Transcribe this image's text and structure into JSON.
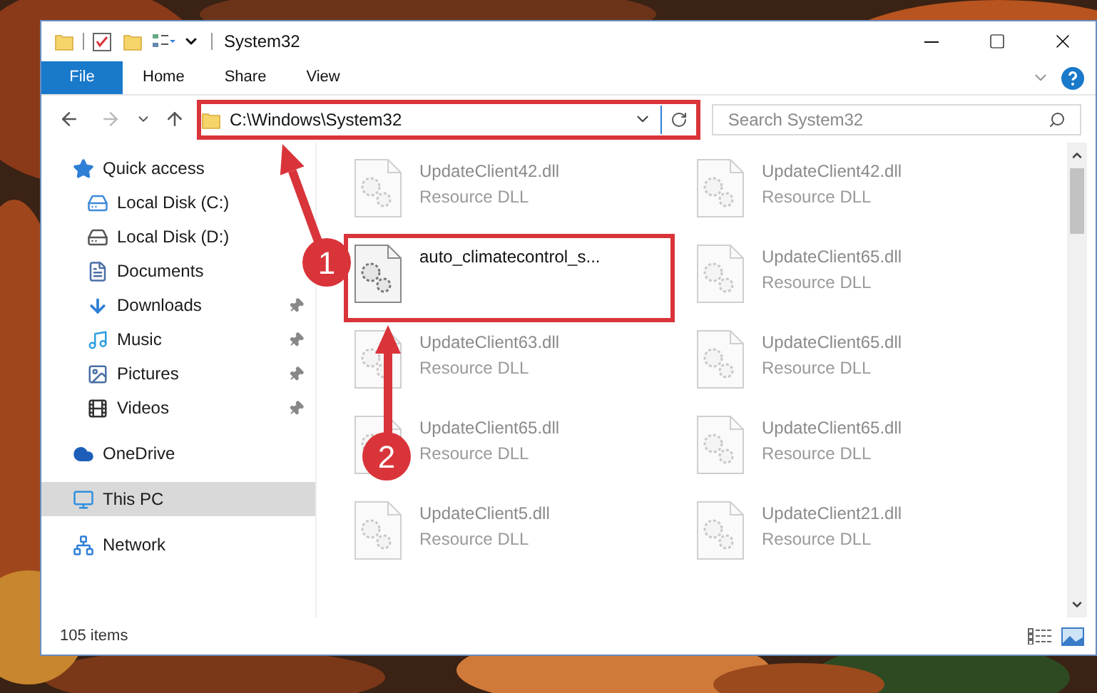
{
  "window": {
    "title": "System32"
  },
  "ribbon_tabs": [
    {
      "label": "File",
      "kind": "file"
    },
    {
      "label": "Home",
      "kind": "tab"
    },
    {
      "label": "Share",
      "kind": "tab"
    },
    {
      "label": "View",
      "kind": "tab"
    }
  ],
  "address_bar": {
    "path": "C:\\Windows\\System32",
    "highlighted": true
  },
  "search": {
    "placeholder": "Search System32"
  },
  "nav": [
    {
      "label": "Quick access",
      "kind": "star",
      "selected": false,
      "children": [
        {
          "label": "Local Disk (C:)",
          "kind": "disk-windows",
          "pinned": false,
          "selected": false
        },
        {
          "label": "Local Disk (D:)",
          "kind": "disk",
          "pinned": false,
          "selected": false
        },
        {
          "label": "Documents",
          "kind": "document",
          "pinned": false,
          "selected": false
        },
        {
          "label": "Downloads",
          "kind": "download",
          "pinned": true,
          "selected": false
        },
        {
          "label": "Music",
          "kind": "music",
          "pinned": true,
          "selected": false
        },
        {
          "label": "Pictures",
          "kind": "pictures",
          "pinned": true,
          "selected": false
        },
        {
          "label": "Videos",
          "kind": "video",
          "pinned": true,
          "selected": false
        }
      ]
    },
    {
      "label": "OneDrive",
      "kind": "cloud",
      "selected": false
    },
    {
      "label": "This PC",
      "kind": "pc",
      "selected": true
    },
    {
      "label": "Network",
      "kind": "network",
      "selected": false
    }
  ],
  "files": [
    {
      "name": "UpdateClient42.dll",
      "type": "Resource DLL",
      "blurred": true,
      "highlighted": false
    },
    {
      "name": "UpdateClient42.dll",
      "type": "Resource DLL",
      "blurred": true,
      "highlighted": false
    },
    {
      "name": "auto_climatecontrol_s...",
      "blurred": false,
      "highlighted": true
    },
    {
      "name": "UpdateClient65.dll",
      "type": "Resource DLL",
      "blurred": true,
      "highlighted": false
    },
    {
      "name": "UpdateClient63.dll",
      "type": "Resource DLL",
      "blurred": true,
      "highlighted": false
    },
    {
      "name": "UpdateClient65.dll",
      "type": "Resource DLL",
      "blurred": true,
      "highlighted": false
    },
    {
      "name": "UpdateClient65.dll",
      "type": "Resource DLL",
      "blurred": true,
      "highlighted": false
    },
    {
      "name": "UpdateClient65.dll",
      "type": "Resource DLL",
      "blurred": true,
      "highlighted": false
    },
    {
      "name": "UpdateClient5.dll",
      "type": "Resource DLL",
      "blurred": true,
      "highlighted": false
    },
    {
      "name": "UpdateClient21.dll",
      "type": "Resource DLL",
      "blurred": true,
      "highlighted": false
    }
  ],
  "status_bar": {
    "item_count": "105 items"
  },
  "steps": [
    {
      "number": "1"
    },
    {
      "number": "2"
    }
  ]
}
